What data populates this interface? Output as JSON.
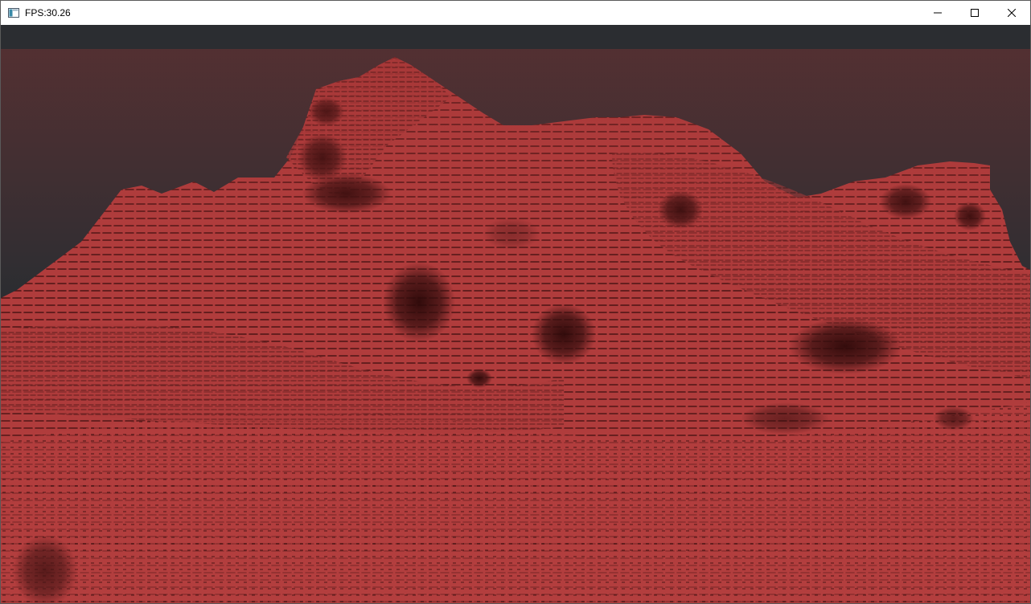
{
  "window": {
    "title": "FPS:30.26",
    "icon": "app-window-icon",
    "controls": {
      "minimize_icon": "minimize-icon",
      "maximize_icon": "maximize-icon",
      "close_icon": "close-icon"
    }
  },
  "scene": {
    "background_color": "#2b2d31",
    "terrain_color": "#b03c3c",
    "terrain_shadow_color": "#3a1010"
  }
}
